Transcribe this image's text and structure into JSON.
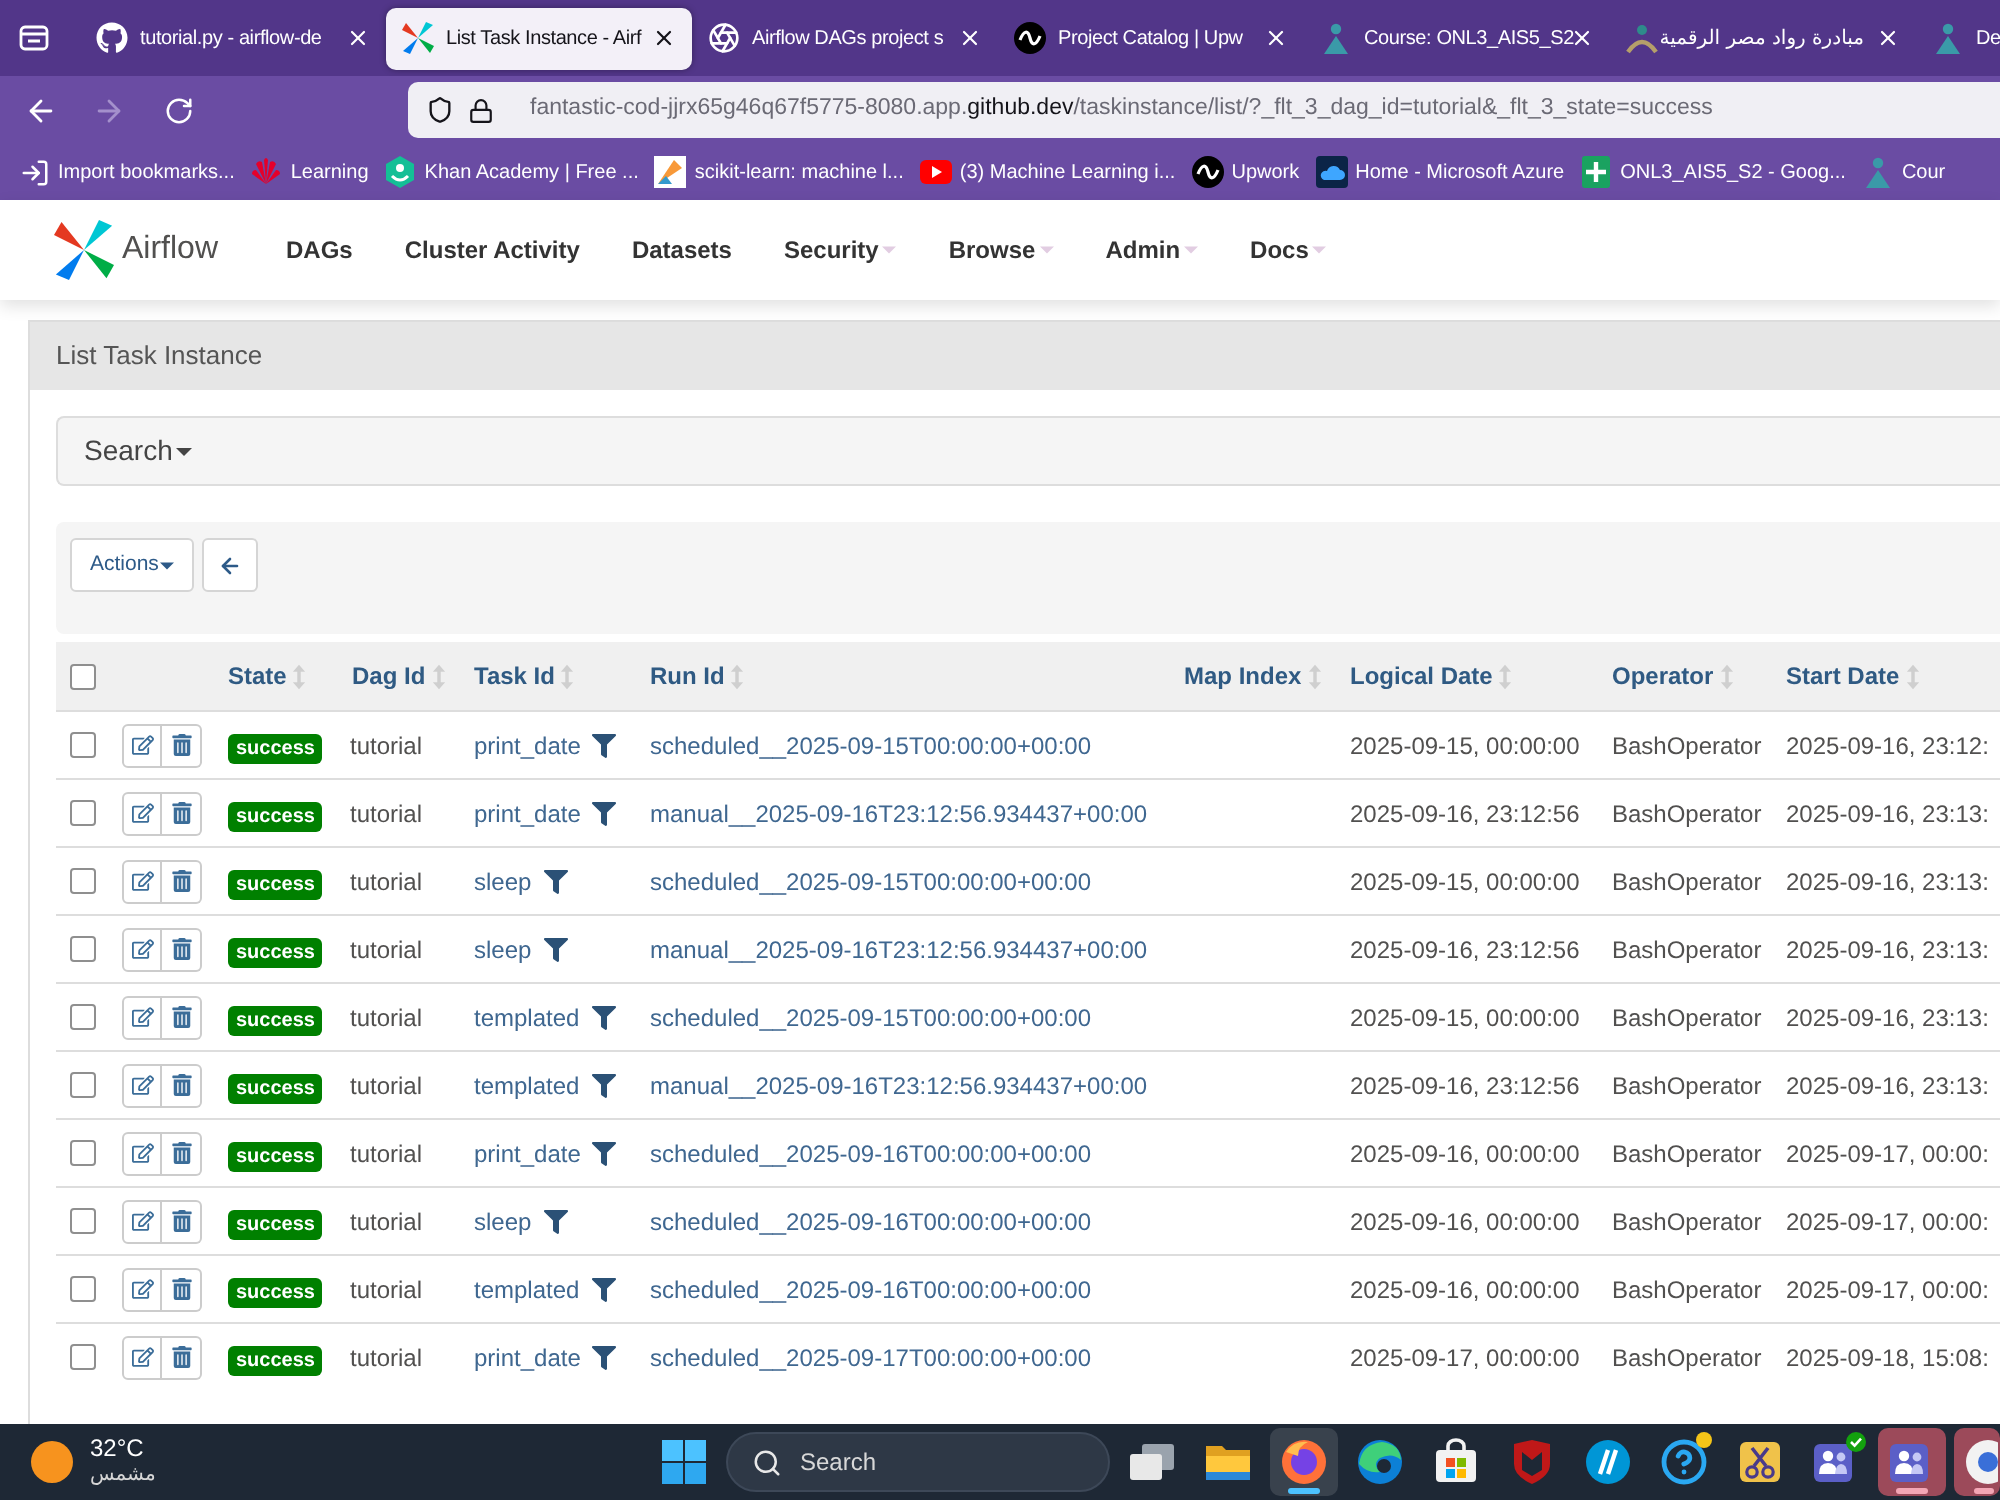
{
  "browser": {
    "tabs": [
      {
        "title": "tutorial.py - airflow-de",
        "selected": false
      },
      {
        "title": "List Task Instance - Airf",
        "selected": true
      },
      {
        "title": "Airflow DAGs project s",
        "selected": false
      },
      {
        "title": "Project Catalog | Upw",
        "selected": false
      },
      {
        "title": "Course: ONL3_AIS5_S2",
        "selected": false
      },
      {
        "title": "مبادرة رواد مصر الرقمية",
        "selected": false
      },
      {
        "title": "De",
        "selected": false
      }
    ],
    "forward_disabled": true,
    "url": {
      "host": "fantastic-cod-jjrx65g46q67f5775-8080.app.",
      "domain": "github.dev",
      "path": "/taskinstance/list/?_flt_3_dag_id=tutorial&_flt_3_state=success"
    },
    "bookmarks": [
      "Import bookmarks...",
      "Learning",
      "Khan Academy | Free ...",
      "scikit-learn: machine l...",
      "(3) Machine Learning i...",
      "Upwork",
      "Home - Microsoft Azure",
      "ONL3_AIS5_S2 - Goog...",
      "Cour"
    ]
  },
  "app": {
    "brand": "Airflow",
    "nav": [
      {
        "label": "DAGs",
        "dropdown": false
      },
      {
        "label": "Cluster Activity",
        "dropdown": false
      },
      {
        "label": "Datasets",
        "dropdown": false
      },
      {
        "label": "Security",
        "dropdown": true
      },
      {
        "label": "Browse",
        "dropdown": true
      },
      {
        "label": "Admin",
        "dropdown": true
      },
      {
        "label": "Docs",
        "dropdown": true
      }
    ]
  },
  "page": {
    "title": "List Task Instance",
    "search": "Search",
    "actions": "Actions"
  },
  "table": {
    "select_all": {
      "checked": false
    },
    "columns": [
      "State",
      "Dag Id",
      "Task Id",
      "Run Id",
      "Map Index",
      "Logical Date",
      "Operator",
      "Start Date"
    ],
    "rows": [
      {
        "checked": false,
        "state": "success",
        "dag_id": "tutorial",
        "task_id": "print_date",
        "run_id": "scheduled__2025-09-15T00:00:00+00:00",
        "logical_date": "2025-09-15, 00:00:00",
        "operator": "BashOperator",
        "start_date": "2025-09-16, 23:12:"
      },
      {
        "checked": false,
        "state": "success",
        "dag_id": "tutorial",
        "task_id": "print_date",
        "run_id": "manual__2025-09-16T23:12:56.934437+00:00",
        "logical_date": "2025-09-16, 23:12:56",
        "operator": "BashOperator",
        "start_date": "2025-09-16, 23:13:"
      },
      {
        "checked": false,
        "state": "success",
        "dag_id": "tutorial",
        "task_id": "sleep",
        "run_id": "scheduled__2025-09-15T00:00:00+00:00",
        "logical_date": "2025-09-15, 00:00:00",
        "operator": "BashOperator",
        "start_date": "2025-09-16, 23:13:"
      },
      {
        "checked": false,
        "state": "success",
        "dag_id": "tutorial",
        "task_id": "sleep",
        "run_id": "manual__2025-09-16T23:12:56.934437+00:00",
        "logical_date": "2025-09-16, 23:12:56",
        "operator": "BashOperator",
        "start_date": "2025-09-16, 23:13:"
      },
      {
        "checked": false,
        "state": "success",
        "dag_id": "tutorial",
        "task_id": "templated",
        "run_id": "scheduled__2025-09-15T00:00:00+00:00",
        "logical_date": "2025-09-15, 00:00:00",
        "operator": "BashOperator",
        "start_date": "2025-09-16, 23:13:"
      },
      {
        "checked": false,
        "state": "success",
        "dag_id": "tutorial",
        "task_id": "templated",
        "run_id": "manual__2025-09-16T23:12:56.934437+00:00",
        "logical_date": "2025-09-16, 23:12:56",
        "operator": "BashOperator",
        "start_date": "2025-09-16, 23:13:"
      },
      {
        "checked": false,
        "state": "success",
        "dag_id": "tutorial",
        "task_id": "print_date",
        "run_id": "scheduled__2025-09-16T00:00:00+00:00",
        "logical_date": "2025-09-16, 00:00:00",
        "operator": "BashOperator",
        "start_date": "2025-09-17, 00:00:"
      },
      {
        "checked": false,
        "state": "success",
        "dag_id": "tutorial",
        "task_id": "sleep",
        "run_id": "scheduled__2025-09-16T00:00:00+00:00",
        "logical_date": "2025-09-16, 00:00:00",
        "operator": "BashOperator",
        "start_date": "2025-09-17, 00:00:"
      },
      {
        "checked": false,
        "state": "success",
        "dag_id": "tutorial",
        "task_id": "templated",
        "run_id": "scheduled__2025-09-16T00:00:00+00:00",
        "logical_date": "2025-09-16, 00:00:00",
        "operator": "BashOperator",
        "start_date": "2025-09-17, 00:00:"
      },
      {
        "checked": false,
        "state": "success",
        "dag_id": "tutorial",
        "task_id": "print_date",
        "run_id": "scheduled__2025-09-17T00:00:00+00:00",
        "logical_date": "2025-09-17, 00:00:00",
        "operator": "BashOperator",
        "start_date": "2025-09-18, 15:08:"
      }
    ]
  },
  "taskbar": {
    "weather": {
      "temperature": "32°C",
      "condition": "مشمس"
    },
    "search": {
      "placeholder": "Search"
    },
    "apps": [
      {
        "active": false,
        "flashing": false
      },
      {
        "active": false,
        "flashing": false
      },
      {
        "active": true,
        "flashing": false
      },
      {
        "active": false,
        "flashing": false
      },
      {
        "active": false,
        "flashing": false
      },
      {
        "active": false,
        "flashing": false
      },
      {
        "active": false,
        "flashing": false
      },
      {
        "active": false,
        "flashing": false
      },
      {
        "active": false,
        "flashing": false
      },
      {
        "active": false,
        "flashing": false
      },
      {
        "active": false,
        "flashing": true
      },
      {
        "active": false,
        "flashing": true
      }
    ]
  }
}
